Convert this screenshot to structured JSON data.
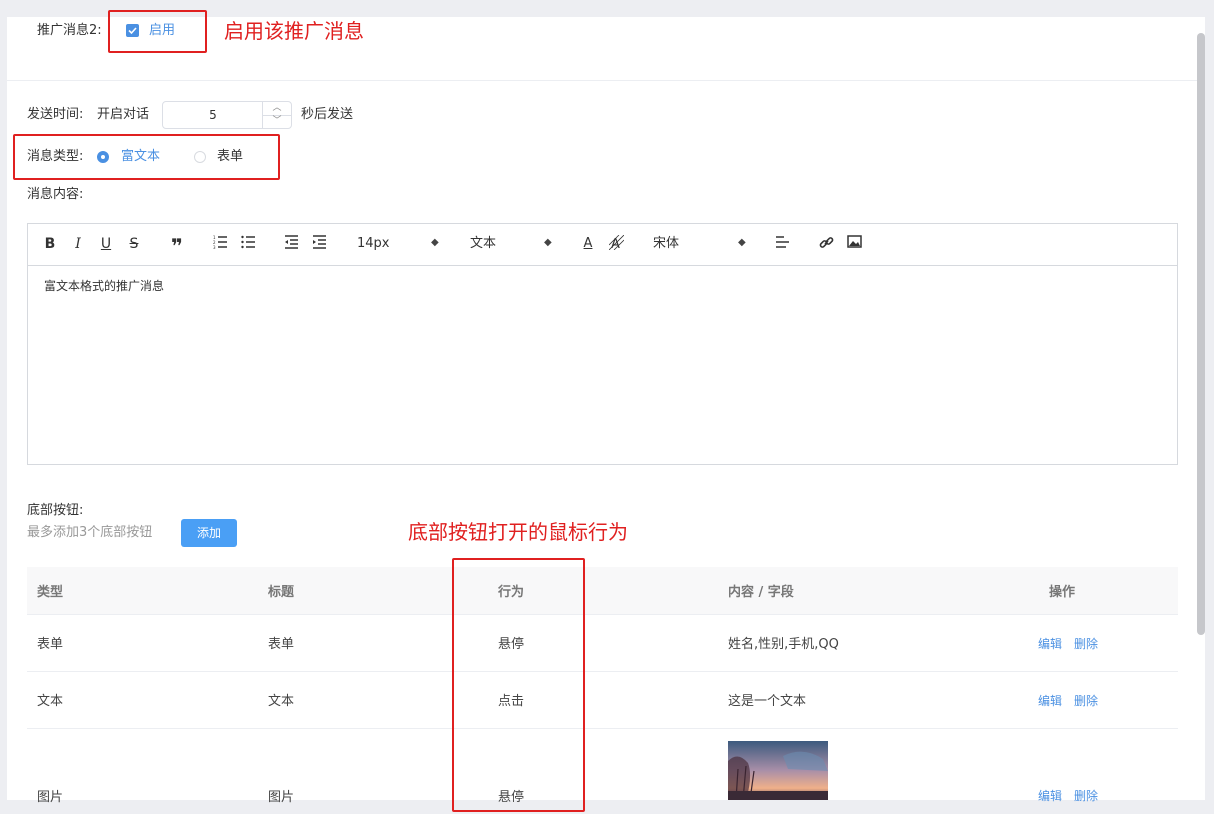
{
  "push": {
    "label": "推广消息2:",
    "enable_label": "启用",
    "annotation": "启用该推广消息"
  },
  "send_time": {
    "label": "发送时间:",
    "prefix": "开启对话",
    "value": "5",
    "suffix": "秒后发送"
  },
  "msg_type": {
    "label": "消息类型:",
    "options": [
      "富文本",
      "表单"
    ],
    "selected": "富文本"
  },
  "content_label": "消息内容:",
  "editor": {
    "tools": [
      "B",
      "I",
      "U",
      "S"
    ],
    "font_size": "14px",
    "block": "文本",
    "font_family": "宋体",
    "content": "富文本格式的推广消息"
  },
  "bottom_buttons": {
    "label": "底部按钮:",
    "hint": "最多添加3个底部按钮",
    "add_label": "添加",
    "annotation": "底部按钮打开的鼠标行为"
  },
  "table": {
    "headers": [
      "类型",
      "标题",
      "行为",
      "内容 / 字段",
      "操作"
    ],
    "rows": [
      {
        "type": "表单",
        "title": "表单",
        "action": "悬停",
        "content": "姓名,性别,手机,QQ"
      },
      {
        "type": "文本",
        "title": "文本",
        "action": "点击",
        "content": "这是一个文本"
      },
      {
        "type": "图片",
        "title": "图片",
        "action": "悬停",
        "content": ""
      }
    ],
    "edit_label": "编辑",
    "delete_label": "删除"
  },
  "colors": {
    "accent": "#4a90e2",
    "annotation": "#e02020",
    "button": "#4a9ff5"
  }
}
